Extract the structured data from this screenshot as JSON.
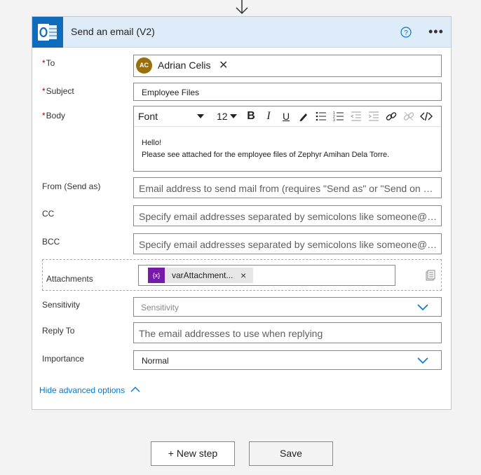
{
  "card": {
    "title": "Send an email (V2)",
    "help_icon": "question-circle-icon",
    "more_icon": "more-ellipsis-icon"
  },
  "to": {
    "label": "To",
    "required": "*",
    "recipient_initials": "AC",
    "recipient_name": "Adrian Celis",
    "recipient_avatar_color": "#986f0b"
  },
  "subject": {
    "label": "Subject",
    "required": "*",
    "value": "Employee Files"
  },
  "body": {
    "label": "Body",
    "required": "*",
    "font": "Font",
    "size": "12",
    "toolbar": {
      "bold": "B",
      "italic": "I",
      "underline": "U"
    },
    "line1": "Hello!",
    "line2": "Please see attached for the employee files of Zephyr Amihan Dela Torre."
  },
  "from": {
    "label": "From (Send as)",
    "placeholder": "Email address to send mail from (requires \"Send as\" or \"Send on be..."
  },
  "cc": {
    "label": "CC",
    "placeholder": "Specify email addresses separated by semicolons like someone@c..."
  },
  "bcc": {
    "label": "BCC",
    "placeholder": "Specify email addresses separated by semicolons like someone@c..."
  },
  "attachments": {
    "label": "Attachments",
    "token_icon": "{x}",
    "token_label": "varAttachment...",
    "token_color": "#7719aa"
  },
  "sensitivity": {
    "label": "Sensitivity",
    "placeholder": "Sensitivity"
  },
  "reply_to": {
    "label": "Reply To",
    "placeholder": "The email addresses to use when replying"
  },
  "importance": {
    "label": "Importance",
    "value": "Normal"
  },
  "advanced": {
    "label": "Hide advanced options"
  },
  "buttons": {
    "new_step": "+ New step",
    "save": "Save"
  },
  "colors": {
    "header_bg": "#deecf9",
    "accent": "#0078d4",
    "outlook_blue": "#0f6cbd",
    "required": "#a80000"
  }
}
